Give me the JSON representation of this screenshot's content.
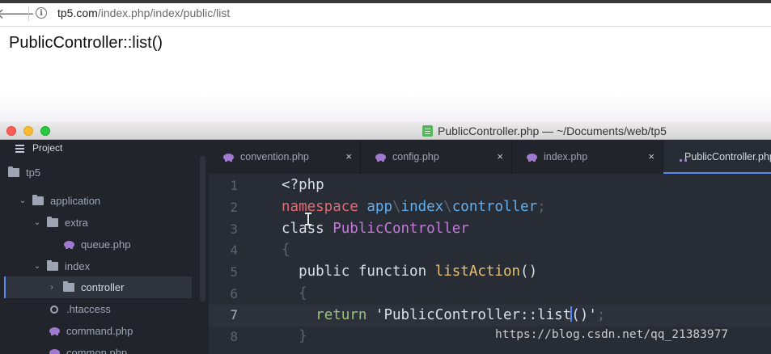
{
  "browser": {
    "url_host": "tp5.com",
    "url_path": "/index.php/index/public/list",
    "back_icon": "arrow-left-icon",
    "info_icon": "info-icon"
  },
  "page": {
    "heading": "PublicController::list()"
  },
  "editor": {
    "window_title": "PublicController.php — ~/Documents/web/tp5",
    "sidebar": {
      "header": "Project",
      "tree": [
        {
          "label": "tp5",
          "type": "folder"
        },
        {
          "label": "application",
          "type": "folder",
          "expanded": true
        },
        {
          "label": "extra",
          "type": "folder",
          "expanded": true
        },
        {
          "label": "queue.php",
          "type": "php"
        },
        {
          "label": "index",
          "type": "folder",
          "expanded": true
        },
        {
          "label": "controller",
          "type": "folder",
          "expanded": false,
          "selected": true
        },
        {
          "label": ".htaccess",
          "type": "config"
        },
        {
          "label": "command.php",
          "type": "php"
        },
        {
          "label": "common.php",
          "type": "php"
        }
      ]
    },
    "tabs": [
      {
        "label": "convention.php",
        "close": "×"
      },
      {
        "label": "config.php",
        "close": "×"
      },
      {
        "label": "index.php",
        "close": "×"
      },
      {
        "label": "PublicController.php",
        "active": true
      }
    ],
    "line_numbers": [
      "1",
      "2",
      "3",
      "4",
      "5",
      "6",
      "7",
      "8"
    ],
    "code": {
      "line1": "<?php",
      "line2_kw": "namespace",
      "line2_a": "app",
      "line2_sep1": "\\",
      "line2_b": "index",
      "line2_sep2": "\\",
      "line2_c": "controller",
      "line2_end": ";",
      "line3_kw": "class",
      "line3_name": "PublicController",
      "line4": "{",
      "line5_kw": "public function",
      "line5_name": "listAction",
      "line5_end": "()",
      "line6": "{",
      "line7_kw": "return",
      "line7_str_a": "'PublicController::list",
      "line7_str_b": "()'",
      "line7_end": ";",
      "line8": "}"
    },
    "watermark": "https://blog.csdn.net/qq_21383977"
  },
  "colors": {
    "accent": "#568af2",
    "editor_bg": "#282c34",
    "sidebar_bg": "#21252b",
    "keyword": "#c678dd",
    "string": "#98c379",
    "class_name": "#e5c07b",
    "function": "#61afef"
  }
}
